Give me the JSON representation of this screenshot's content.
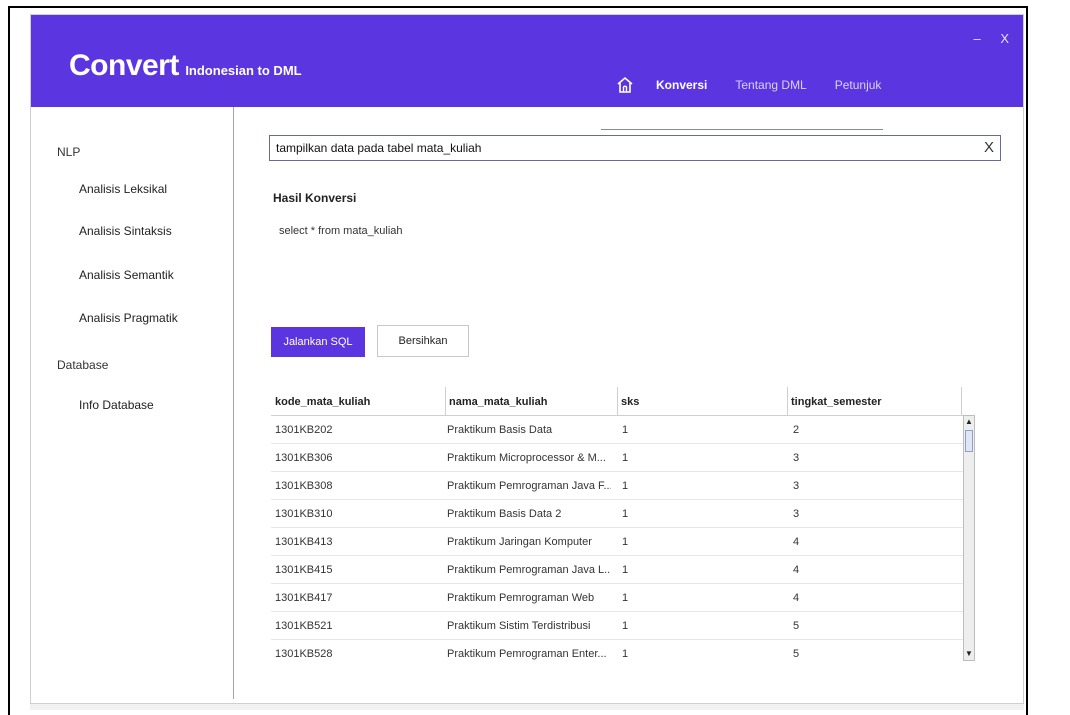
{
  "app": {
    "logo_main": "Convert",
    "logo_sub": "Indonesian to DML",
    "window_controls": {
      "minimize": "–",
      "close": "X"
    }
  },
  "nav": {
    "home_icon": "home-icon",
    "items": [
      {
        "label": "Konversi",
        "active": true
      },
      {
        "label": "Tentang DML",
        "active": false
      },
      {
        "label": "Petunjuk",
        "active": false
      }
    ]
  },
  "sidebar": {
    "sections": [
      {
        "title": "NLP",
        "items": [
          "Analisis Leksikal",
          "Analisis Sintaksis",
          "Analisis Semantik",
          "Analisis Pragmatik"
        ]
      },
      {
        "title": "Database",
        "items": [
          "Info Database"
        ]
      }
    ]
  },
  "search": {
    "value": "tampilkan data pada tabel mata_kuliah",
    "clear_label": "X"
  },
  "result": {
    "label": "Hasil Konversi",
    "sql": "select * from mata_kuliah"
  },
  "buttons": {
    "run": "Jalankan SQL",
    "clear": "Bersihkan"
  },
  "table": {
    "columns": [
      "kode_mata_kuliah",
      "nama_mata_kuliah",
      "sks",
      "tingkat_semester"
    ],
    "rows": [
      [
        "1301KB202",
        "Praktikum Basis Data",
        "1",
        "2"
      ],
      [
        "1301KB306",
        "Praktikum Microprocessor & M...",
        "1",
        "3"
      ],
      [
        "1301KB308",
        "Praktikum Pemrograman Java F...",
        "1",
        "3"
      ],
      [
        "1301KB310",
        "Praktikum Basis Data 2",
        "1",
        "3"
      ],
      [
        "1301KB413",
        "Praktikum Jaringan Komputer",
        "1",
        "4"
      ],
      [
        "1301KB415",
        "Praktikum Pemrograman Java L...",
        "1",
        "4"
      ],
      [
        "1301KB417",
        "Praktikum Pemrograman Web",
        "1",
        "4"
      ],
      [
        "1301KB521",
        "Praktikum Sistim Terdistribusi",
        "1",
        "5"
      ],
      [
        "1301KB528",
        "Praktikum Pemrograman Enter...",
        "1",
        "5"
      ]
    ]
  },
  "colors": {
    "accent": "#5a35e0",
    "header_text": "#ffffff"
  }
}
